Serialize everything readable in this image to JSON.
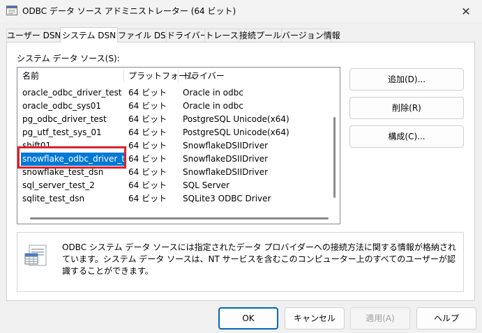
{
  "window": {
    "title": "ODBC データ ソース アドミニストレーター (64 ビット)",
    "close_symbol": "✕",
    "icon": "odbc-app-icon"
  },
  "tabs": [
    {
      "label": "ユーザー DSN",
      "active": false
    },
    {
      "label": "システム DSN",
      "active": true
    },
    {
      "label": "ファイル DSN",
      "active": false
    },
    {
      "label": "ドライバー",
      "active": false
    },
    {
      "label": "トレース",
      "active": false
    },
    {
      "label": "接続プール",
      "active": false
    },
    {
      "label": "バージョン情報",
      "active": false
    }
  ],
  "list": {
    "label": "システム データ ソース(S):",
    "columns": [
      "名前",
      "プラットフォーム",
      "ドライバー"
    ],
    "rows": [
      [
        "oracle_odbc_driver_test",
        "64 ビット",
        "Oracle in odbc"
      ],
      [
        "oracle_odbc_sys01",
        "64 ビット",
        "Oracle in odbc"
      ],
      [
        "pg_odbc_driver_test",
        "64 ビット",
        "PostgreSQL Unicode(x64)"
      ],
      [
        "pg_utf_test_sys_01",
        "64 ビット",
        "PostgreSQL Unicode(x64)"
      ],
      [
        "shift01",
        "64 ビット",
        "SnowflakeDSIIDriver"
      ],
      [
        "snowflake_odbc_driver_test",
        "64 ビット",
        "SnowflakeDSIIDriver"
      ],
      [
        "snowflake_test_dsn",
        "64 ビット",
        "SnowflakeDSIIDriver"
      ],
      [
        "sql_server_test_2",
        "64 ビット",
        "SQL Server"
      ],
      [
        "sqlite_test_dsn",
        "64 ビット",
        "SQLite3 ODBC Driver"
      ]
    ],
    "selected_index": 5,
    "highlight_color": "#e0202a",
    "selection_color": "#0078d7"
  },
  "side_buttons": {
    "add": "追加(D)...",
    "remove": "削除(R)",
    "configure": "構成(C)..."
  },
  "info": {
    "text": "ODBC システム データ ソースには指定されたデータ プロバイダーへの接続方法に関する情報が格納されています。システム データ ソースは、NT サービスを含むこのコンピューター上のすべてのユーザーが認識することができます。",
    "icon": "data-source-icon"
  },
  "footer_buttons": {
    "ok": "OK",
    "cancel": "キャンセル",
    "apply": "適用(A)",
    "help": "ヘルプ"
  }
}
